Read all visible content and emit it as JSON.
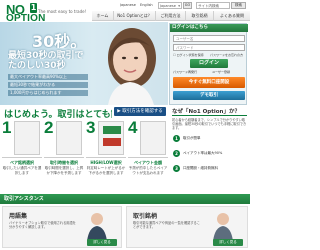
{
  "header": {
    "logo_no": "NO",
    "logo_badge": "1",
    "logo_option": "OPTION",
    "tagline": "The most easy to trade!",
    "lang_jp": "Japanese",
    "lang_en": "English",
    "select_value": "Japanese",
    "go_label": "GO",
    "search_placeholder": "サイト内検索",
    "search_button": "検索"
  },
  "nav": {
    "items": [
      "ホーム",
      "No1 Optionとは？",
      "ご利用方法",
      "取引銘柄",
      "よくある質問"
    ]
  },
  "hero": {
    "headline": "30秒。",
    "sub_line1": "最短30秒の取引で",
    "sub_line2": "たのしい30秒",
    "bullets": [
      "最大ペイアウト率最高90%以上",
      "最短30秒で結果がわかる",
      "1,000円からはじめられます"
    ]
  },
  "login": {
    "title": "ログインはこちら",
    "user_placeholder": "ユーザー名",
    "pass_placeholder": "パスワード",
    "remember": "ログイン状態を保持",
    "forgot": "パスワードをお忘れの方",
    "button": "ログイン",
    "link1": "パスワード再発行",
    "link2": "ユーザー登録",
    "signup_button": "今すぐ無料口座開設",
    "demo_button": "デモ取引"
  },
  "steps": {
    "heading": "はじめよう。取引はとても簡単！",
    "demo_button": "取引方法を確認する",
    "items": [
      {
        "num": "1",
        "title": "ペア銘柄選択",
        "desc": "取引したい通貨ペアを選択します"
      },
      {
        "num": "2",
        "title": "取引時間を選択",
        "desc": "取引時間を選択し、上昇か下降かを予測します"
      },
      {
        "num": "3",
        "title": "HIGH/LOW選択",
        "desc": "判定時レートが上がるか下がるかを選択します"
      },
      {
        "num": "4",
        "title": "ペイアウト金額",
        "desc": "予測が的中したらペイアウトが支払われます"
      }
    ]
  },
  "why": {
    "heading": "なぜ「No1 Option」か？",
    "text": "初心者から経験者まで、シンプルで分かりやすい取引画面。最短30秒の取引でいつでも手軽に取引できます。",
    "points": [
      {
        "num": "1",
        "label": "取引が簡単"
      },
      {
        "num": "2",
        "label": "ペイアウト率は最大90%"
      },
      {
        "num": "3",
        "label": "口座開設・維持費無料"
      }
    ]
  },
  "assist": {
    "heading": "取引アシスタンス",
    "cards": [
      {
        "title": "用語集",
        "text": "バイナリーオプション取引で使用される用語を分かりやすく解説します。",
        "button": "詳しく見る"
      },
      {
        "title": "取引銘柄",
        "text": "取引可能な通貨ペアや商品の一覧を確認することができます。",
        "button": "詳しく見る"
      }
    ]
  },
  "colors": {
    "brand_green": "#0a7d3a",
    "signup_orange": "#f07818",
    "demo_blue": "#2a86b8",
    "nav_blue": "#1a4f85"
  }
}
